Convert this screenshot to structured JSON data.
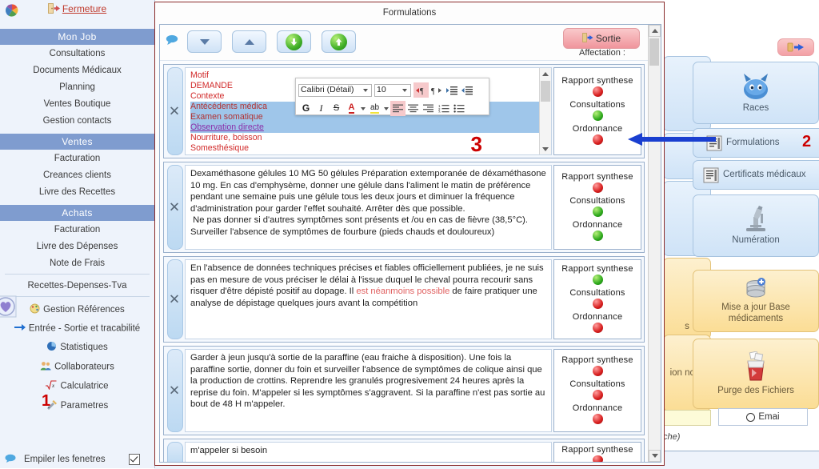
{
  "app": {
    "close_label": "Fermeture"
  },
  "sidebar": {
    "sections": [
      {
        "header": "Mon Job",
        "items": [
          {
            "label": "Consultations",
            "icon": ""
          },
          {
            "label": "Documents Médicaux",
            "icon": ""
          },
          {
            "label": "Planning",
            "icon": ""
          },
          {
            "label": "Ventes Boutique",
            "icon": ""
          },
          {
            "label": "Gestion contacts",
            "icon": ""
          }
        ]
      },
      {
        "header": "Ventes",
        "items": [
          {
            "label": "Facturation",
            "icon": ""
          },
          {
            "label": "Creances clients",
            "icon": ""
          },
          {
            "label": "Livre des Recettes",
            "icon": ""
          }
        ]
      },
      {
        "header": "Achats",
        "items": [
          {
            "label": "Facturation",
            "icon": ""
          },
          {
            "label": "Livre des Dépenses",
            "icon": ""
          },
          {
            "label": "Note de Frais",
            "icon": ""
          }
        ]
      }
    ],
    "extra_items": [
      {
        "label": "Recettes-Depenses-Tva",
        "icon": ""
      },
      {
        "label": "Gestion Références",
        "icon": "palette-icon"
      },
      {
        "label": "Entrée - Sortie et tracabilité",
        "icon": "arrow-right-icon"
      },
      {
        "label": "Statistiques",
        "icon": "pie-chart-icon"
      },
      {
        "label": "Collaborateurs",
        "icon": "people-icon"
      },
      {
        "label": "Calculatrice",
        "icon": "sqrt-icon"
      },
      {
        "label": "Parametres",
        "icon": "tools-icon"
      }
    ],
    "stack_windows": {
      "label": "Empiler les fenetres",
      "checked": true
    },
    "annotation_1": "1"
  },
  "window": {
    "title": "Formulations",
    "toolbar": {
      "buttons": [
        {
          "name": "comment-icon",
          "label": ""
        },
        {
          "name": "move-down-button",
          "label": ""
        },
        {
          "name": "move-up-button",
          "label": ""
        },
        {
          "name": "download-button",
          "label": ""
        },
        {
          "name": "upload-button",
          "label": ""
        }
      ],
      "sortie_label": "Sortie",
      "affectation_label": "Affectation :"
    },
    "rich_text_toolbar": {
      "font_name": "Calibri (Détail)",
      "font_size": "10",
      "bold": "G",
      "italic": "I",
      "strike": "S",
      "font_color": "A",
      "highlight": "ab",
      "buttons": [
        "ltr-paragraph",
        "rtl-paragraph",
        "increase-indent",
        "decrease-indent",
        "align-left",
        "align-center",
        "align-right",
        "numbered-list",
        "bulleted-list"
      ]
    },
    "annotation_3": "3",
    "rows": [
      {
        "type": "list",
        "lines": [
          {
            "text": "Motif",
            "style": "red"
          },
          {
            "text": "DEMANDE",
            "style": "red"
          },
          {
            "text": "Contexte",
            "style": "red"
          },
          {
            "text": "Antécédents médica",
            "style": "selected"
          },
          {
            "text": "Examen somatique",
            "style": "selected"
          },
          {
            "text": "Observation directe",
            "style": "selected-underline"
          },
          {
            "text": "Nourriture, boisson",
            "style": "red"
          },
          {
            "text": "Somesthésique",
            "style": "red"
          }
        ],
        "affectation": [
          {
            "label": "Rapport synthese",
            "state": "red"
          },
          {
            "label": "Consultations",
            "state": "green"
          },
          {
            "label": "Ordonnance",
            "state": "red"
          }
        ]
      },
      {
        "type": "text",
        "text": "Dexaméthasone gélules 10 MG 50 gélules Préparation extemporanée de déxaméthasone 10 mg. En cas d'emphysème, donner une gélule dans l'aliment le matin de préférence pendant une semaine puis une gélule tous les deux jours et diminuer la fréquence d'administration pour garder l'effet souhaité. Arrêter dès que possible.\n Ne pas donner si d'autres symptômes sont présents et /ou en cas de fièvre (38,5°C). Surveiller l'absence de symptômes de fourbure (pieds chauds et douloureux)",
        "affectation": [
          {
            "label": "Rapport synthese",
            "state": "red"
          },
          {
            "label": "Consultations",
            "state": "green"
          },
          {
            "label": "Ordonnance",
            "state": "green"
          }
        ]
      },
      {
        "type": "text-highlight",
        "text_before": "En l'absence de données techniques précises et fiables officiellement publiées, je ne suis pas en mesure de vous préciser le délai à l'issue duquel le cheval pourra recourir sans risquer d'être dépisté positif au dopage. Il ",
        "text_highlight": "est néanmoins possible",
        "text_after": " de faire pratiquer une analyse de dépistage quelques jours avant la compétition",
        "affectation": [
          {
            "label": "Rapport synthese",
            "state": "green"
          },
          {
            "label": "Consultations",
            "state": "red"
          },
          {
            "label": "Ordonnance",
            "state": "red"
          }
        ]
      },
      {
        "type": "text",
        "text": "Garder à jeun jusqu'à sortie de la paraffine (eau fraiche à disposition). Une fois la paraffine sortie, donner du foin et surveiller l'absence de symptômes de colique ainsi que la production de crottins. Reprendre les granulés progresivement 24 heures après la reprise du foin. M'appeler si les symptômes s'aggravent. Si la paraffine n'est pas sortie au bout de 48 H m'appeler.",
        "affectation": [
          {
            "label": "Rapport synthese",
            "state": "red"
          },
          {
            "label": "Consultations",
            "state": "red"
          },
          {
            "label": "Ordonnance",
            "state": "red"
          }
        ]
      },
      {
        "type": "text",
        "text": "m'appeler si besoin",
        "affectation": [
          {
            "label": "Rapport synthese",
            "state": "red"
          },
          {
            "label": "",
            "state": ""
          },
          {
            "label": "",
            "state": ""
          }
        ]
      }
    ]
  },
  "right_panel": {
    "back_button": "",
    "buttons": [
      {
        "label": "Races",
        "icon": "animal-icon",
        "color": "blue"
      },
      {
        "label": "Formulations",
        "icon": "document-icon",
        "color": "blue"
      },
      {
        "label": "Certificats médicaux",
        "icon": "document-icon",
        "color": "blue"
      },
      {
        "label": "Numération",
        "icon": "microscope-icon",
        "color": "blue"
      },
      {
        "label": "Mise a jour Base médicaments",
        "icon": "database-icon",
        "color": "orange"
      },
      {
        "label": "Purge des Fichiers",
        "icon": "trash-icon",
        "color": "orange"
      }
    ],
    "annotation_2": "2",
    "email_option": "Emai",
    "hidden_button_labels": [
      "ion nces",
      "s"
    ],
    "bottom_note": "che)"
  },
  "colors": {
    "sidebar_header": "#7f9ccf",
    "sidebar_bg": "#eef3fb",
    "window_border": "#8a2b2b",
    "accent_red": "#cc0000",
    "sortie_pink": "#f0959c",
    "status_red": "#d81f1f",
    "status_green": "#2faa1d",
    "annotation_arrow": "#1a3fd0"
  }
}
